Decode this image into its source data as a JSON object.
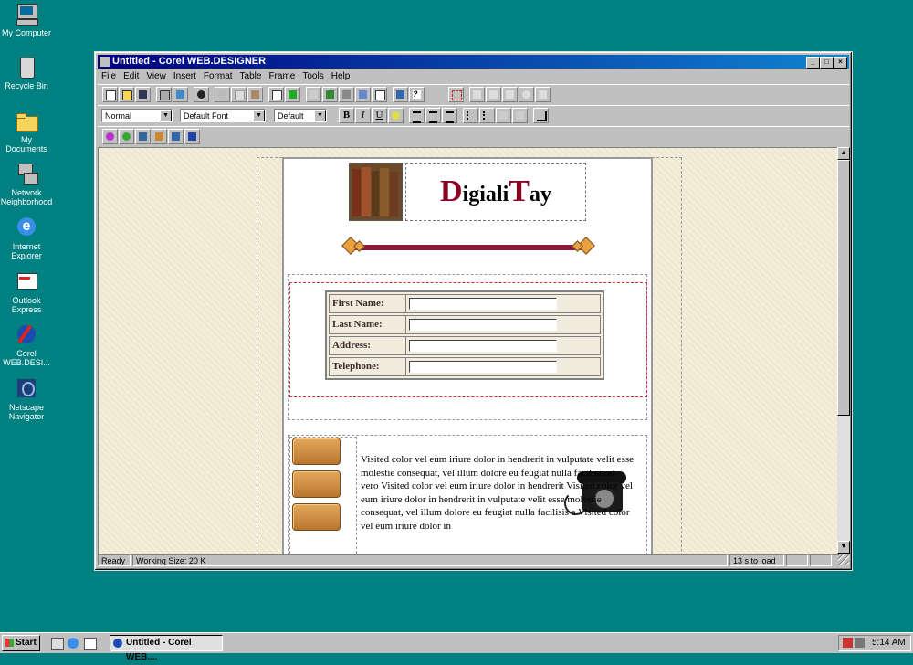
{
  "desktop": {
    "icons": [
      {
        "label": "My Computer"
      },
      {
        "label": "Recycle Bin"
      },
      {
        "label": "My Documents"
      },
      {
        "label": "Network Neighborhood"
      },
      {
        "label": "Internet Explorer"
      },
      {
        "label": "Outlook Express"
      },
      {
        "label": "Corel WEB.DESI..."
      },
      {
        "label": "Netscape Navigator"
      }
    ]
  },
  "window": {
    "title": "Untitled - Corel WEB.DESIGNER",
    "menu": [
      "File",
      "Edit",
      "View",
      "Insert",
      "Format",
      "Table",
      "Frame",
      "Tools",
      "Help"
    ],
    "toolbar": {
      "style_combo": "Normal",
      "font_combo": "Default Font",
      "size_combo": "Default",
      "bold": "B",
      "italic": "I",
      "underline": "U"
    },
    "status": {
      "ready": "Ready",
      "working_size": "Working Size: 20 K",
      "load_time": "13 s to load"
    }
  },
  "document": {
    "logo_text_d": "D",
    "logo_text_1": "igiali",
    "logo_text_t": "T",
    "logo_text_2": "ay",
    "form": {
      "fields": [
        {
          "label": "First Name:"
        },
        {
          "label": "Last Name:"
        },
        {
          "label": "Address:"
        },
        {
          "label": "Telephone:"
        }
      ]
    },
    "body_text": "Visited color vel eum iriure dolor in hendrerit in vulputate velit esse molestie consequat, vel illum dolore eu feugiat nulla facilisis at vero Visited color vel eum iriure dolor in hendrerit Visited color vel eum iriure dolor in hendrerit in vulputate velit esse molestie consequat, vel illum dolore eu feugiat nulla facilisis a Visited color vel eum iriure dolor in"
  },
  "taskbar": {
    "start_label": "Start",
    "task_label": "Untitled - Corel WEB....",
    "clock": "5:14 AM"
  },
  "colors": {
    "desktop": "#008080",
    "title_bar": "#000080",
    "logo_red": "#8b0020",
    "divider_bar": "#8b1a3a"
  }
}
